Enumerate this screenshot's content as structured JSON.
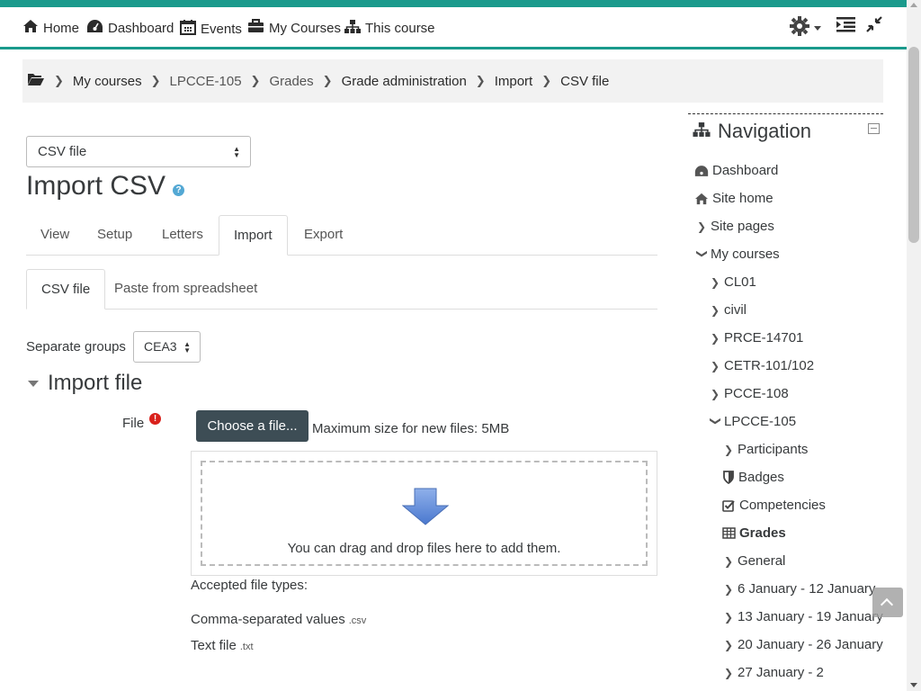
{
  "navbar": {
    "items": [
      {
        "label": "Home",
        "icon": "home-icon"
      },
      {
        "label": "Dashboard",
        "icon": "dashboard-icon"
      },
      {
        "label": "Events",
        "icon": "calendar-icon"
      },
      {
        "label": "My Courses",
        "icon": "briefcase-icon"
      },
      {
        "label": "This course",
        "icon": "sitemap-icon"
      }
    ],
    "right_icons": [
      "gear-icon",
      "outdent-icon",
      "compress-icon"
    ],
    "accent": "#1a9a8c"
  },
  "breadcrumb": [
    "My courses",
    "LPCCE-105",
    "Grades",
    "Grade administration",
    "Import",
    "CSV file"
  ],
  "jump_select": {
    "value": "CSV file"
  },
  "page_title": "Import CSV",
  "tabs": [
    "View",
    "Setup",
    "Letters",
    "Import",
    "Export"
  ],
  "active_tab": "Import",
  "subtabs": [
    "CSV file",
    "Paste from spreadsheet"
  ],
  "groups": {
    "label": "Separate groups",
    "value": "CEA3"
  },
  "import_section": {
    "title": "Import file",
    "file_label": "File",
    "choose_button": "Choose a file...",
    "max_size": "Maximum size for new files: 5MB",
    "drop_text": "You can drag and drop files here to add them.",
    "accepted_label": "Accepted file types:",
    "file_types": [
      {
        "name": "Comma-separated values",
        "ext": ".csv"
      },
      {
        "name": "Text file",
        "ext": ".txt"
      }
    ]
  },
  "sidebar": {
    "title": "Navigation",
    "nodes": [
      {
        "label": "Dashboard",
        "icon": "dashboard-icon"
      },
      {
        "label": "Site home",
        "icon": "home-icon"
      },
      {
        "label": "Site pages",
        "icon": "chevron-right-icon"
      },
      {
        "label": "My courses",
        "icon": "chevron-down-icon"
      },
      {
        "label": "CL01",
        "icon": "chevron-right-icon"
      },
      {
        "label": "civil",
        "icon": "chevron-right-icon"
      },
      {
        "label": "PRCE-14701",
        "icon": "chevron-right-icon"
      },
      {
        "label": "CETR-101/102",
        "icon": "chevron-right-icon"
      },
      {
        "label": "PCCE-108",
        "icon": "chevron-right-icon"
      },
      {
        "label": "LPCCE-105",
        "icon": "chevron-down-icon"
      },
      {
        "label": "Participants",
        "icon": "chevron-right-icon"
      },
      {
        "label": "Badges",
        "icon": "shield-icon"
      },
      {
        "label": "Competencies",
        "icon": "checkbox-icon"
      },
      {
        "label": "Grades",
        "icon": "table-icon"
      },
      {
        "label": "General",
        "icon": "chevron-right-icon"
      },
      {
        "label": "6 January - 12 January",
        "icon": "chevron-right-icon"
      },
      {
        "label": "13 January - 19 January",
        "icon": "chevron-right-icon"
      },
      {
        "label": "20 January - 26 January",
        "icon": "chevron-right-icon"
      },
      {
        "label": "27 January - 2",
        "icon": "chevron-right-icon"
      }
    ]
  }
}
